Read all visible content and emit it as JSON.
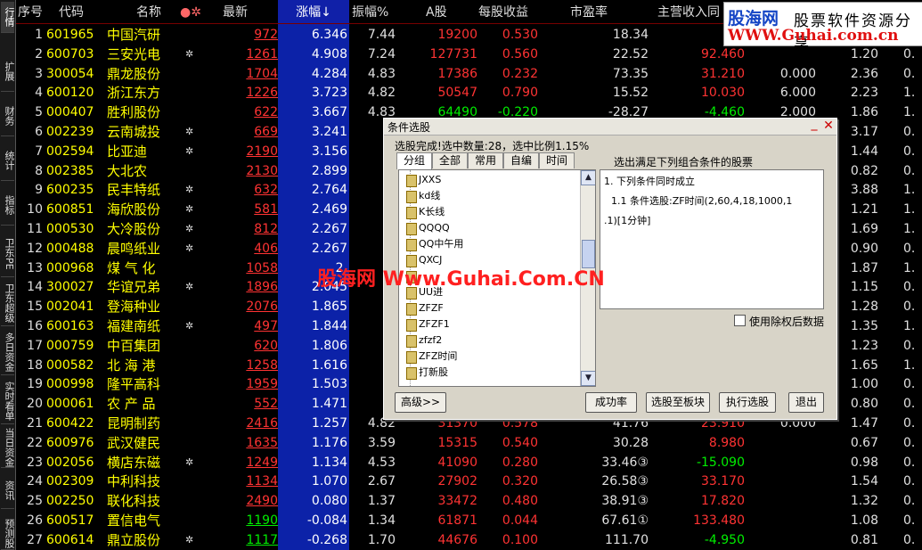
{
  "left_tabs": [
    "行情",
    "扩展",
    "财务",
    "统计",
    "指标",
    "卫东PE",
    "卫东超级",
    "多日资金",
    "实时看单",
    "当日资金",
    "资讯",
    "预测股"
  ],
  "header": {
    "cols": [
      "序号",
      "代码",
      "名称",
      "●✲",
      "最新",
      "涨幅↓",
      "振幅%",
      "A股",
      "每股收益",
      "市盈率",
      "主营收入同"
    ]
  },
  "logo": {
    "line1": "股海网",
    "line2": "股票软件资源分享",
    "line3": "WWW.Guhai.com.cn"
  },
  "watermark": "股海网 Www.Guhai.Com.CN",
  "rows": [
    {
      "n": "1",
      "code": "601965",
      "name": "中国汽研",
      "mark": "",
      "price": "972",
      "chg": "6.346",
      "amp": "7.44",
      "ashare": "19200",
      "eps": "0.530",
      "pe": "18.34",
      "rev": "-4",
      "c1": "",
      "c2": "",
      "c3": ""
    },
    {
      "n": "2",
      "code": "600703",
      "name": "三安光电",
      "mark": "✲",
      "price": "1261",
      "chg": "4.908",
      "amp": "7.24",
      "ashare": "127731",
      "eps": "0.560",
      "pe": "22.52",
      "rev": "92.460",
      "c1": "",
      "c2": "1.20",
      "c3": "0."
    },
    {
      "n": "3",
      "code": "300054",
      "name": "鼎龙股份",
      "mark": "",
      "price": "1704",
      "chg": "4.284",
      "amp": "4.83",
      "ashare": "17386",
      "eps": "0.232",
      "pe": "73.35",
      "rev": "31.210",
      "c1": "0.000",
      "c2": "2.36",
      "c3": "0."
    },
    {
      "n": "4",
      "code": "600120",
      "name": "浙江东方",
      "mark": "",
      "price": "1226",
      "chg": "3.723",
      "amp": "4.82",
      "ashare": "50547",
      "eps": "0.790",
      "pe": "15.52",
      "rev": "10.030",
      "c1": "6.000",
      "c2": "2.23",
      "c3": "1."
    },
    {
      "n": "5",
      "code": "000407",
      "name": "胜利股份",
      "mark": "",
      "price": "622",
      "chg": "3.667",
      "amp": "4.83",
      "ashare": "64490",
      "eps": "-0.220",
      "pe": "-28.27",
      "rev": "-4.460",
      "c1": "2.000",
      "c2": "1.86",
      "c3": "1."
    },
    {
      "n": "6",
      "code": "002239",
      "name": "云南城投",
      "mark": "✲",
      "price": "669",
      "chg": "3.241",
      "amp": "5.",
      "ashare": "",
      "eps": "",
      "pe": "",
      "rev": "",
      "c1": "",
      "c2": "3.17",
      "c3": "0."
    },
    {
      "n": "7",
      "code": "002594",
      "name": "比亚迪",
      "mark": "✲",
      "price": "2190",
      "chg": "3.156",
      "amp": "4.",
      "ashare": "",
      "eps": "",
      "pe": "",
      "rev": "",
      "c1": "",
      "c2": "1.44",
      "c3": "0."
    },
    {
      "n": "8",
      "code": "002385",
      "name": "大北农",
      "mark": "",
      "price": "2130",
      "chg": "2.899",
      "amp": "3.",
      "ashare": "",
      "eps": "",
      "pe": "",
      "rev": "",
      "c1": "",
      "c2": "0.82",
      "c3": "0."
    },
    {
      "n": "9",
      "code": "600235",
      "name": "民丰特纸",
      "mark": "✲",
      "price": "632",
      "chg": "2.764",
      "amp": "4.",
      "ashare": "",
      "eps": "",
      "pe": "",
      "rev": "",
      "c1": "",
      "c2": "3.88",
      "c3": "1."
    },
    {
      "n": "10",
      "code": "600851",
      "name": "海欣股份",
      "mark": "✲",
      "price": "581",
      "chg": "2.469",
      "amp": "6.",
      "ashare": "",
      "eps": "",
      "pe": "",
      "rev": "",
      "c1": "",
      "c2": "1.21",
      "c3": "1."
    },
    {
      "n": "11",
      "code": "000530",
      "name": "大冷股份",
      "mark": "✲",
      "price": "812",
      "chg": "2.267",
      "amp": "3.",
      "ashare": "",
      "eps": "",
      "pe": "",
      "rev": "",
      "c1": "",
      "c2": "1.69",
      "c3": "1."
    },
    {
      "n": "12",
      "code": "000488",
      "name": "晨鸣纸业",
      "mark": "✲",
      "price": "406",
      "chg": "2.267",
      "amp": "3.",
      "ashare": "",
      "eps": "",
      "pe": "",
      "rev": "",
      "c1": "",
      "c2": "0.90",
      "c3": "0."
    },
    {
      "n": "13",
      "code": "000968",
      "name": "煤 气 化",
      "mark": "",
      "price": "1058",
      "chg": "2.",
      "amp": "",
      "ashare": "",
      "eps": "",
      "pe": "",
      "rev": "",
      "c1": "",
      "c2": "1.87",
      "c3": "1."
    },
    {
      "n": "14",
      "code": "300027",
      "name": "华谊兄弟",
      "mark": "✲",
      "price": "1896",
      "chg": "2.045",
      "amp": "3.",
      "ashare": "",
      "eps": "",
      "pe": "",
      "rev": "",
      "c1": "",
      "c2": "1.15",
      "c3": "0."
    },
    {
      "n": "15",
      "code": "002041",
      "name": "登海种业",
      "mark": "",
      "price": "2076",
      "chg": "1.865",
      "amp": "2.",
      "ashare": "",
      "eps": "",
      "pe": "",
      "rev": "",
      "c1": "",
      "c2": "1.28",
      "c3": "0."
    },
    {
      "n": "16",
      "code": "600163",
      "name": "福建南纸",
      "mark": "✲",
      "price": "497",
      "chg": "1.844",
      "amp": "3.",
      "ashare": "",
      "eps": "",
      "pe": "",
      "rev": "",
      "c1": "",
      "c2": "1.35",
      "c3": "1."
    },
    {
      "n": "17",
      "code": "000759",
      "name": "中百集团",
      "mark": "",
      "price": "620",
      "chg": "1.806",
      "amp": "3.",
      "ashare": "",
      "eps": "",
      "pe": "",
      "rev": "",
      "c1": "",
      "c2": "1.23",
      "c3": "0."
    },
    {
      "n": "18",
      "code": "000582",
      "name": "北 海 港",
      "mark": "",
      "price": "1258",
      "chg": "1.616",
      "amp": "3.",
      "ashare": "",
      "eps": "",
      "pe": "",
      "rev": "",
      "c1": "",
      "c2": "1.65",
      "c3": "1."
    },
    {
      "n": "19",
      "code": "000998",
      "name": "隆平高科",
      "mark": "",
      "price": "1959",
      "chg": "1.503",
      "amp": "2.",
      "ashare": "",
      "eps": "",
      "pe": "",
      "rev": "",
      "c1": "",
      "c2": "1.00",
      "c3": "0."
    },
    {
      "n": "20",
      "code": "000061",
      "name": "农 产 品",
      "mark": "",
      "price": "552",
      "chg": "1.471",
      "amp": "3.",
      "ashare": "",
      "eps": "",
      "pe": "",
      "rev": "",
      "c1": "",
      "c2": "0.80",
      "c3": "0."
    },
    {
      "n": "21",
      "code": "600422",
      "name": "昆明制药",
      "mark": "",
      "price": "2416",
      "chg": "1.257",
      "amp": "4.82",
      "ashare": "31370",
      "eps": "0.578",
      "pe": "41.76",
      "rev": "23.910",
      "c1": "0.000",
      "c2": "1.47",
      "c3": "0."
    },
    {
      "n": "22",
      "code": "600976",
      "name": "武汉健民",
      "mark": "",
      "price": "1635",
      "chg": "1.176",
      "amp": "3.59",
      "ashare": "15315",
      "eps": "0.540",
      "pe": "30.28",
      "rev": "8.980",
      "c1": "",
      "c2": "0.67",
      "c3": "0."
    },
    {
      "n": "23",
      "code": "002056",
      "name": "横店东磁",
      "mark": "✲",
      "price": "1249",
      "chg": "1.134",
      "amp": "4.53",
      "ashare": "41090",
      "eps": "0.280",
      "pe": "33.46③",
      "rev": "-15.090",
      "c1": "",
      "c2": "0.98",
      "c3": "0."
    },
    {
      "n": "24",
      "code": "002309",
      "name": "中利科技",
      "mark": "",
      "price": "1134",
      "chg": "1.070",
      "amp": "2.67",
      "ashare": "27902",
      "eps": "0.320",
      "pe": "26.58③",
      "rev": "33.170",
      "c1": "",
      "c2": "1.54",
      "c3": "0."
    },
    {
      "n": "25",
      "code": "002250",
      "name": "联化科技",
      "mark": "",
      "price": "2490",
      "chg": "0.080",
      "amp": "1.37",
      "ashare": "33472",
      "eps": "0.480",
      "pe": "38.91③",
      "rev": "17.820",
      "c1": "",
      "c2": "1.32",
      "c3": "0."
    },
    {
      "n": "26",
      "code": "600517",
      "name": "置信电气",
      "mark": "",
      "price": "1190",
      "chg": "-0.084",
      "amp": "1.34",
      "ashare": "61871",
      "eps": "0.044",
      "pe": "67.61①",
      "rev": "133.480",
      "c1": "",
      "c2": "1.08",
      "c3": "0."
    },
    {
      "n": "27",
      "code": "600614",
      "name": "鼎立股份",
      "mark": "✲",
      "price": "1117",
      "chg": "-0.268",
      "amp": "1.70",
      "ashare": "44676",
      "eps": "0.100",
      "pe": "111.70",
      "rev": "-4.950",
      "c1": "",
      "c2": "0.81",
      "c3": "0."
    }
  ],
  "dialog": {
    "title": "条件选股",
    "status": "选股完成!选中数量:28，选中比例1.15%",
    "tabs": [
      "分组",
      "全部",
      "常用",
      "自编",
      "时间"
    ],
    "list_items": [
      "JXXS",
      "kd线",
      "K长线",
      "QQQQ",
      "QQ中午用",
      "QXCJ",
      "",
      "UU进",
      "ZFZF",
      "ZFZF1",
      "zfzf2",
      "ZFZ时间",
      "打新股"
    ],
    "right_label": "选出满足下列组合条件的股票",
    "conditions": [
      "1. 下列条件同时成立",
      "1.1  条件选股:ZF时间(2,60,4,18,1000,1",
      ".1)[1分钟]"
    ],
    "checkbox_label": "使用除权后数据",
    "buttons": {
      "advanced": "高级>>",
      "success_rate": "成功率",
      "to_block": "选股至板块",
      "execute": "执行选股",
      "exit": "退出"
    }
  }
}
